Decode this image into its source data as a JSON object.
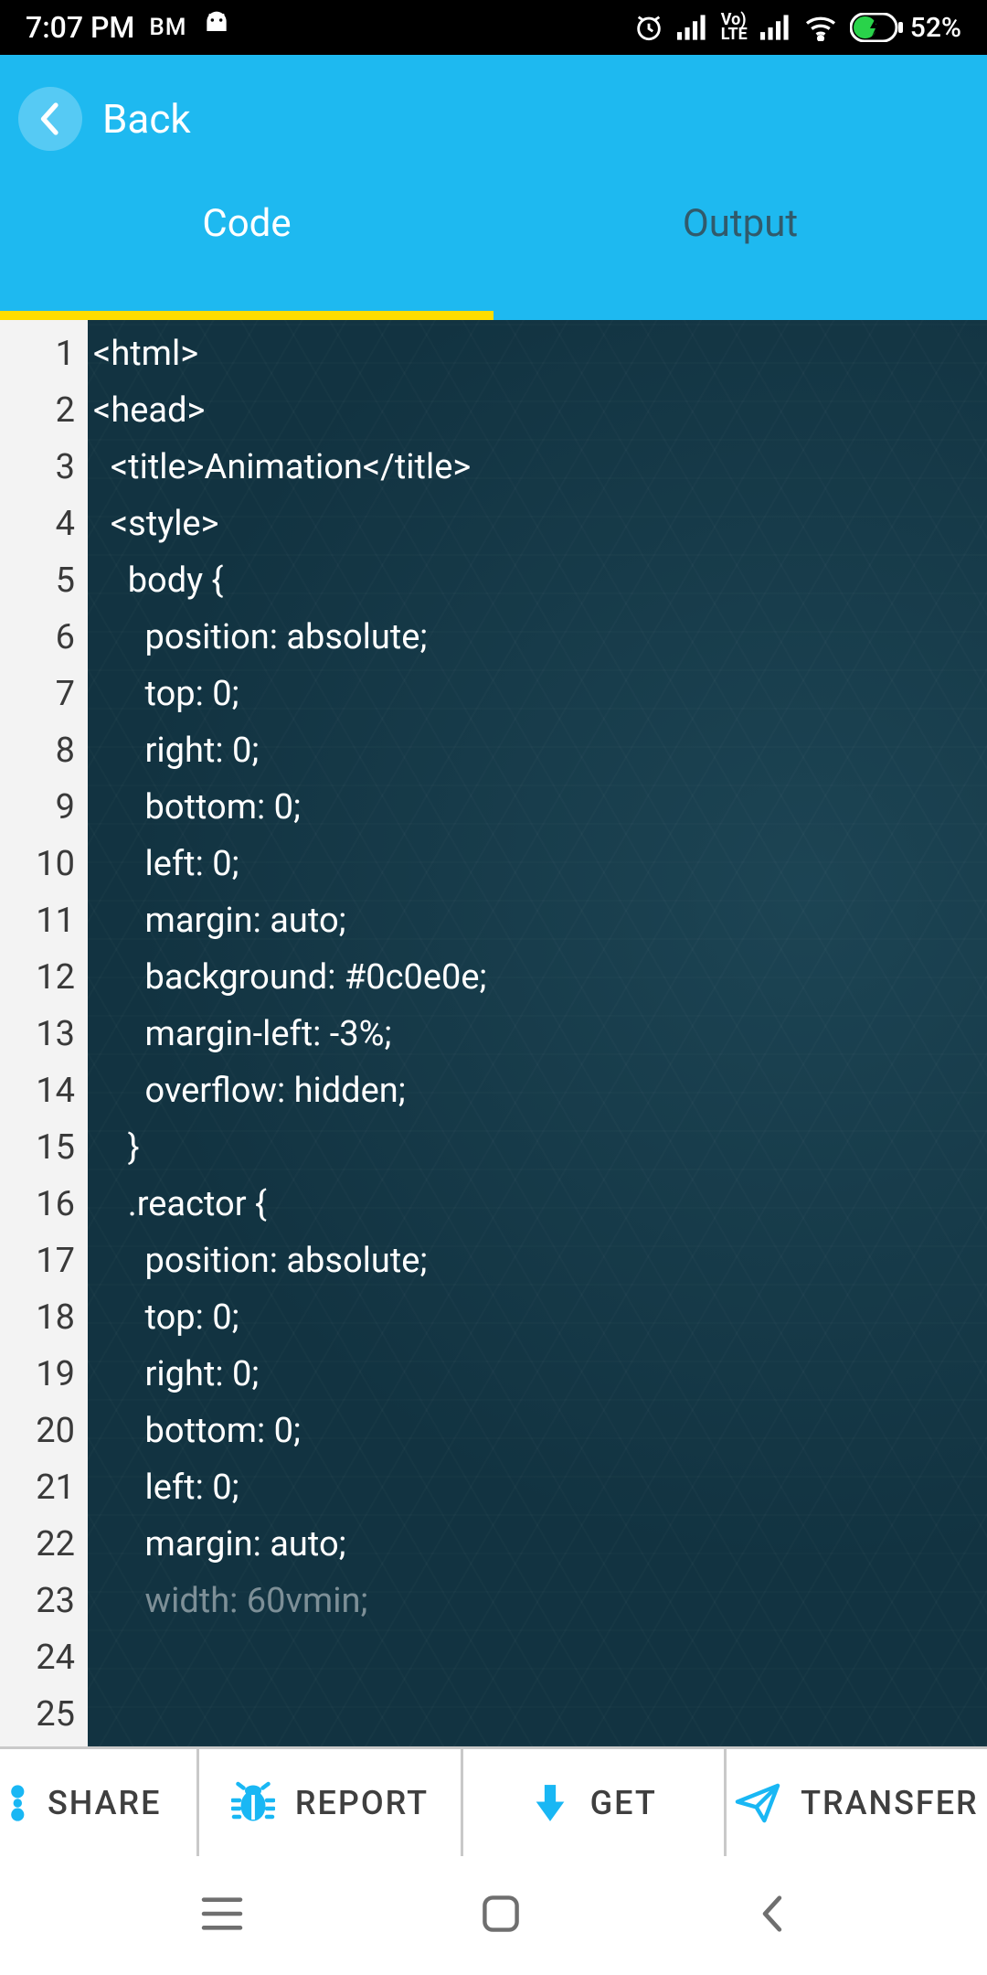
{
  "status": {
    "time": "7:07 PM",
    "carrier": "BM",
    "battery_pct": "52%"
  },
  "header": {
    "back_label": "Back",
    "tabs": [
      {
        "label": "Code",
        "active": true
      },
      {
        "label": "Output",
        "active": false
      }
    ]
  },
  "editor": {
    "lines": [
      "<html>",
      "",
      "<head>",
      "  <title>Animation</title>",
      "",
      "  <style>",
      "    body {",
      "      position: absolute;",
      "      top: 0;",
      "      right: 0;",
      "      bottom: 0;",
      "      left: 0;",
      "      margin: auto;",
      "      background: #0c0e0e;",
      "      margin-left: -3%;",
      "      overflow: hidden;",
      "    }",
      "",
      "    .reactor {",
      "      position: absolute;",
      "      top: 0;",
      "      right: 0;",
      "      bottom: 0;",
      "      left: 0;",
      "      margin: auto;",
      "      width: 60vmin;"
    ]
  },
  "actions": {
    "share": "SHARE",
    "report": "REPORT",
    "get": "GET",
    "transfer": "TRANSFER"
  },
  "colors": {
    "accent": "#1eb9f0",
    "tab_indicator": "#ffdd00",
    "icon_blue": "#19b7f4"
  }
}
